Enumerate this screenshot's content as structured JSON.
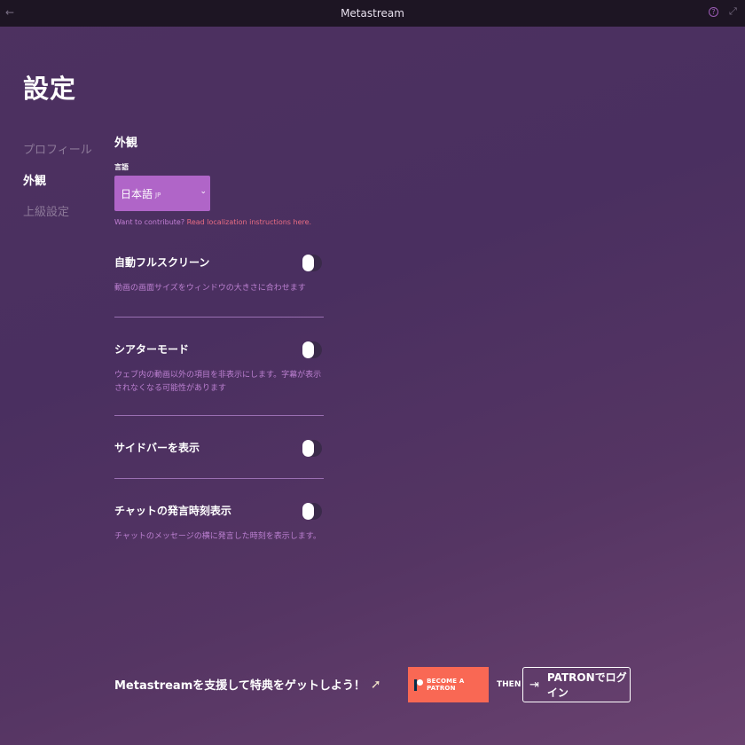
{
  "window": {
    "title": "Metastream",
    "back_icon": "←",
    "help_icon": "?",
    "expand_icon": "⤢"
  },
  "page": {
    "title": "設定"
  },
  "nav": {
    "items": [
      {
        "label": "プロフィール",
        "active": false
      },
      {
        "label": "外観",
        "active": true
      },
      {
        "label": "上級設定",
        "active": false
      }
    ]
  },
  "appearance": {
    "section_title": "外観",
    "language_label": "言語",
    "language_value": "日本語",
    "language_code": "JP",
    "contribute_text": "Want to contribute?",
    "contribute_link": "Read localization instructions here."
  },
  "settings": [
    {
      "name": "自動フルスクリーン",
      "desc": "動画の画面サイズをウィンドウの大きさに合わせます",
      "enabled": false
    },
    {
      "name": "シアターモード",
      "desc": "ウェブ内の動画以外の項目を非表示にします。字幕が表示されなくなる可能性があります",
      "enabled": false
    },
    {
      "name": "サイドバーを表示",
      "desc": "",
      "enabled": false
    },
    {
      "name": "チャットの発言時刻表示",
      "desc": "チャットのメッセージの横に発言した時刻を表示します。",
      "enabled": false
    }
  ],
  "footer": {
    "support_text": "Metastreamを支援して特典をゲットしよう！",
    "become_patron": "BECOME A PATRON",
    "then": "THEN",
    "login_label": "PATRONでログイン"
  },
  "colors": {
    "accent": "#b065c8",
    "patreon": "#f96854"
  }
}
